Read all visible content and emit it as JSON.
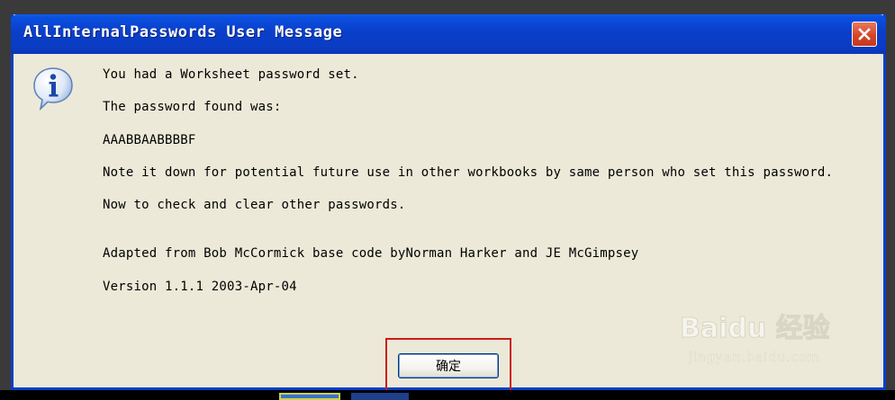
{
  "window": {
    "title": "AllInternalPasswords User Message",
    "close_icon": "close-icon"
  },
  "message": {
    "icon": "info-icon",
    "line1": "You had a Worksheet password set.",
    "line2": "The password found was:",
    "line3": "AAABBAABBBBF",
    "line4": "Note it down for potential future use in other workbooks by same person who set this password.",
    "line5": "Now to check and clear other passwords.",
    "line6": "Adapted from Bob McCormick base code byNorman Harker and JE McGimpsey",
    "line7": "Version 1.1.1 2003-Apr-04"
  },
  "buttons": {
    "ok_label": "确定"
  },
  "watermark": {
    "logo": "Baidu 经验",
    "url": "jingyan.baidu.com"
  },
  "colors": {
    "titlebar": "#0a3fc9",
    "dialog_bg": "#ece9d8",
    "close_button": "#d6452a",
    "highlight": "#cc1a1a"
  }
}
